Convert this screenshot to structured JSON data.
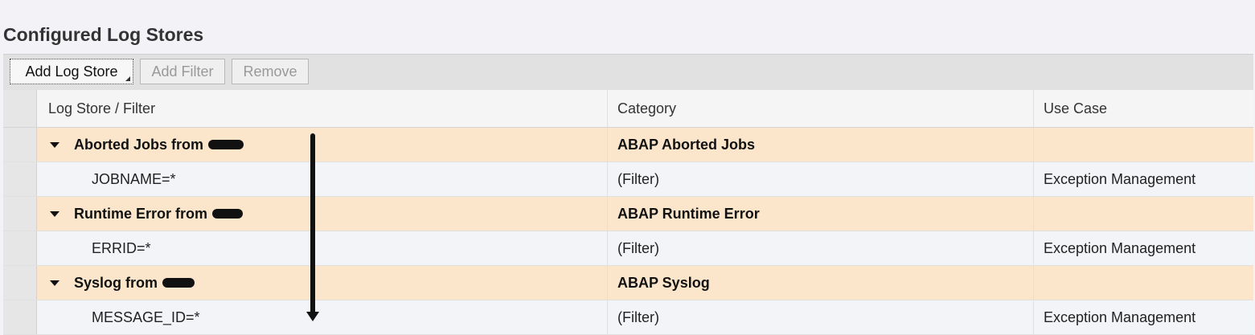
{
  "page": {
    "title": "Configured Log Stores"
  },
  "toolbar": {
    "add_log_store": "Add Log Store",
    "add_filter": "Add Filter",
    "remove": "Remove"
  },
  "table": {
    "columns": [
      "Log Store / Filter",
      "Category",
      "Use Case"
    ],
    "rows": [
      {
        "type": "group",
        "name": "Aborted Jobs from",
        "category": "ABAP Aborted Jobs",
        "use_case": ""
      },
      {
        "type": "filter",
        "name": "JOBNAME=*",
        "category": "(Filter)",
        "use_case": "Exception Management"
      },
      {
        "type": "group",
        "name": "Runtime Error from",
        "category": "ABAP Runtime Error",
        "use_case": ""
      },
      {
        "type": "filter",
        "name": "ERRID=*",
        "category": "(Filter)",
        "use_case": "Exception Management"
      },
      {
        "type": "group",
        "name": "Syslog from",
        "category": "ABAP Syslog",
        "use_case": ""
      },
      {
        "type": "filter",
        "name": "MESSAGE_ID=*",
        "category": "(Filter)",
        "use_case": "Exception Management"
      }
    ]
  },
  "icons": {
    "expander": "triangle-down-icon",
    "annotation": "arrow-down-icon"
  }
}
